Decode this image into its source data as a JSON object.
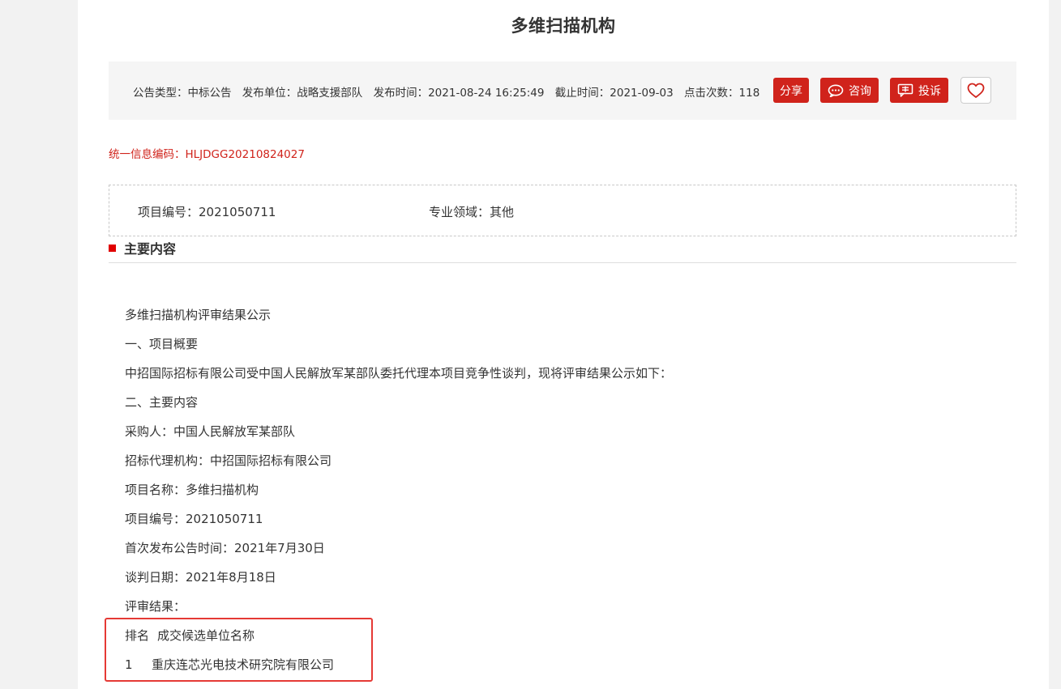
{
  "title": "多维扫描机构",
  "meta": {
    "type_label": "公告类型：",
    "type_value": "中标公告",
    "unit_label": "发布单位：",
    "unit_value": "战略支援部队",
    "publish_label": "发布时间：",
    "publish_value": "2021-08-24 16:25:49",
    "deadline_label": "截止时间：",
    "deadline_value": "2021-09-03",
    "clicks_label": "点击次数：",
    "clicks_value": "118"
  },
  "buttons": {
    "share": "分享",
    "consult": "咨询",
    "complain": "投诉"
  },
  "info_code": "统一信息编码：HLJDGG20210824027",
  "project": {
    "number": "项目编号：2021050711",
    "field": "专业领域：其他"
  },
  "section_title": "主要内容",
  "content_lines": [
    "多维扫描机构评审结果公示",
    "一、项目概要",
    "中招国际招标有限公司受中国人民解放军某部队委托代理本项目竞争性谈判，现将评审结果公示如下：",
    "二、主要内容",
    "采购人：中国人民解放军某部队",
    "招标代理机构：中招国际招标有限公司",
    "项目名称：多维扫描机构",
    "项目编号：2021050711",
    "首次发布公告时间：2021年7月30日",
    "谈判日期：2021年8月18日",
    "评审结果："
  ],
  "result_table": {
    "header_rank": "排名",
    "header_name": "成交候选单位名称",
    "row_rank": "1",
    "row_name": "重庆连芯光电技术研究院有限公司"
  },
  "colors": {
    "accent": "#d0231b",
    "highlight": "#e53935",
    "meta_bg": "#f5f5f5"
  }
}
